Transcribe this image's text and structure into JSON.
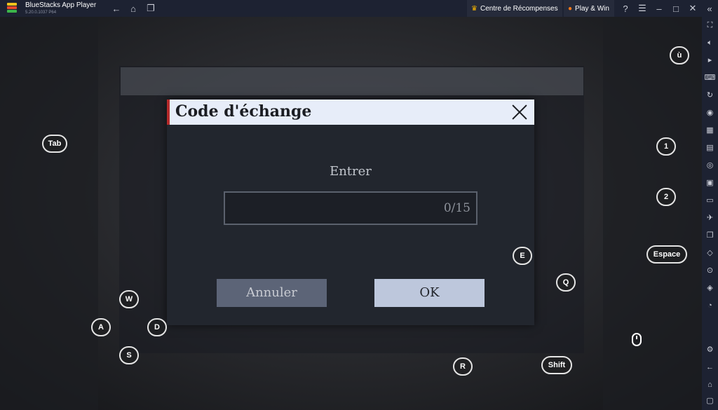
{
  "titlebar": {
    "app_name": "BlueStacks App Player",
    "version": "5.20.0.1037  P64",
    "reward_label": "Centre de  Récompenses",
    "playwin_label": "Play & Win"
  },
  "dialog": {
    "title": "Code d'échange",
    "enter_label": "Entrer",
    "input_value": "",
    "counter": "0/15",
    "cancel_label": "Annuler",
    "ok_label": "OK"
  },
  "keys": {
    "tab": "Tab",
    "u_grave": "ù",
    "one": "1",
    "two": "2",
    "space": "Espace",
    "e": "E",
    "q": "Q",
    "w": "W",
    "a": "A",
    "d": "D",
    "s": "S",
    "r": "R",
    "shift": "Shift"
  },
  "icons": {
    "titlebar": [
      "back-arrow-icon",
      "home-icon",
      "multi-instance-icon",
      "crown-icon",
      "fire-icon",
      "help-icon",
      "menu-icon",
      "minimize-icon",
      "maximize-icon",
      "close-icon",
      "collapse-sidebar-icon"
    ],
    "sidebar": [
      "fullscreen-icon",
      "volume-icon",
      "media-icon",
      "keyboard-icon",
      "rotate-icon",
      "sync-icon",
      "macro-icon",
      "apk-icon",
      "screenshot-icon",
      "record-icon",
      "folder-icon",
      "airplane-icon",
      "multi-instance-icon",
      "eco-icon",
      "location-icon",
      "layers-icon",
      "sync-clock-icon",
      "settings-icon",
      "back-icon",
      "home-icon",
      "recent-apps-icon"
    ]
  },
  "colors": {
    "titlebar_bg": "#1d2232",
    "dialog_header_bg": "#e7edf9",
    "dialog_accent": "#b52a2a",
    "ok_button_bg": "#bdc7dc",
    "cancel_button_bg": "#5c6477"
  }
}
